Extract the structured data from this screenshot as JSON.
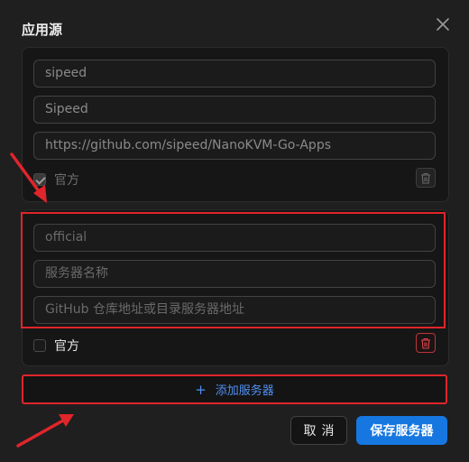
{
  "dialog": {
    "title": "应用源",
    "close_icon": "close-icon"
  },
  "source_1": {
    "name_value": "sipeed",
    "display_name_value": "Sipeed",
    "url_value": "https://github.com/sipeed/NanoKVM-Go-Apps",
    "official_label": "官方",
    "official_checked": true
  },
  "source_2": {
    "name_placeholder": "official",
    "display_name_placeholder": "服务器名称",
    "url_placeholder": "GitHub 仓库地址或目录服务器地址",
    "official_label": "官方",
    "official_checked": false
  },
  "actions": {
    "add_server_label": "添加服务器",
    "cancel_label": "取消",
    "save_label": "保存服务器"
  },
  "colors": {
    "accent": "#1677e0",
    "link": "#4f8ff0",
    "annotation_red": "#e0252b",
    "danger": "#e0434a"
  }
}
